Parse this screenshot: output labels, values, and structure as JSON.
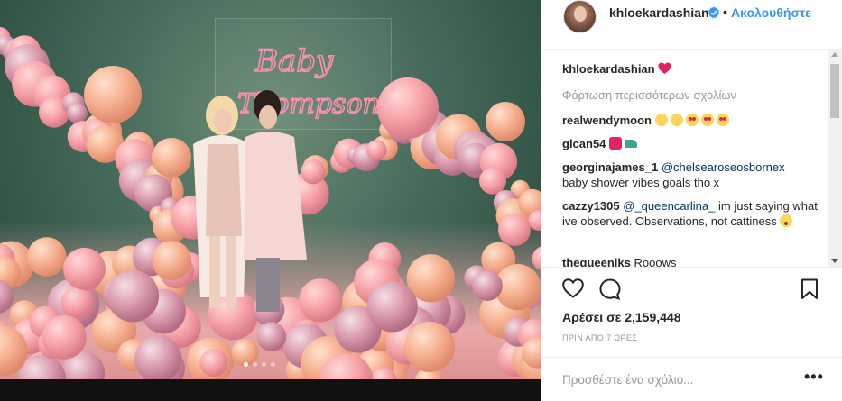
{
  "post": {
    "neon_sign_text": "Baby Thompson",
    "carousel": {
      "count": 4,
      "active": 1
    }
  },
  "header": {
    "username": "khloekardashian",
    "separator": "•",
    "follow_label": "Ακολουθήστε"
  },
  "comments": {
    "caption_user": "khloekardashian",
    "load_more": "Φόρτωση περισσότερων σχολίων",
    "items": [
      {
        "user": "realwendymoon",
        "mention": "",
        "text": ""
      },
      {
        "user": "glcan54",
        "mention": "",
        "text": ""
      },
      {
        "user": "georginajames_1",
        "mention": "@chelsearoseosbornex",
        "text": "baby shower vibes goals tho x"
      },
      {
        "user": "cazzy1305",
        "mention": "@_queencarlina_",
        "text": "im just saying what ive observed. Observations, not cattiness"
      },
      {
        "user": "thequeeniks",
        "mention": "",
        "text": "Rooows"
      }
    ]
  },
  "icons": {
    "like": "heart-outline-icon",
    "comment": "comment-bubble-icon",
    "save": "bookmark-icon",
    "verified": "verified-badge-icon"
  },
  "likes": {
    "label": "Αρέσει σε 2,159,448"
  },
  "timestamp": "ΠΡΙΝ ΑΠΟ 7 ΩΡΕΣ",
  "add_comment": {
    "placeholder": "Προσθέστε ένα σχόλιο...",
    "more_label": "•••"
  },
  "colors": {
    "link": "#3897f0",
    "mention": "#003569",
    "muted": "#999999",
    "text": "#262626"
  }
}
